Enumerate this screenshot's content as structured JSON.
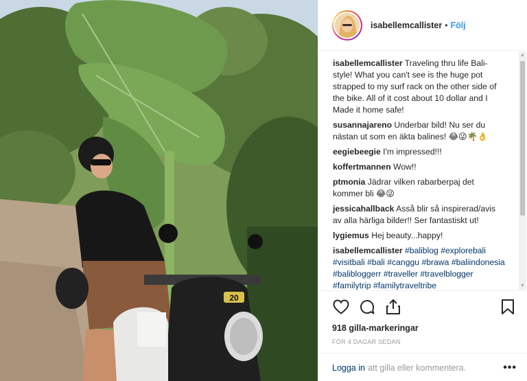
{
  "post": {
    "username": "isabellemcallister",
    "dot": "•",
    "follow_label": "Följ"
  },
  "comments": [
    {
      "user": "isabellemcallister",
      "text": "Traveling thru life Bali-style! What you can't see is the huge pot strapped to my surf rack on the other side of the bike. All of it cost about 10 dollar and I Made it home safe!"
    },
    {
      "user": "susannajareno",
      "text": "Underbar bild! Nu ser du nästan ut som en äkta balines! 😂😜🌴👌"
    },
    {
      "user": "eegiebeegie",
      "text": "I'm impressed!!!"
    },
    {
      "user": "koffertmannen",
      "text": "Wow!!"
    },
    {
      "user": "ptmonia",
      "text": "Jädrar vilken rabarberpaj det kommer bli 😂😜"
    },
    {
      "user": "jessicahallback",
      "text": "Asså blir så inspirerad/avis av alla härliga bilder!! Ser fantastiskt ut!"
    },
    {
      "user": "lygiemus",
      "text": "Hej beauty...happy!"
    }
  ],
  "hashtag_comment": {
    "user": "isabellemcallister",
    "tags": [
      "#baliblog",
      "#explorebali",
      "#visitbali",
      "#bali",
      "#canggu",
      "#brawa",
      "#baliindonesia",
      "#balibloggerr",
      "#traveller",
      "#travelblogger",
      "#familytrip",
      "#familytraveltribe"
    ]
  },
  "likes_text": "918 gilla-markeringar",
  "time_text": "FÖR 4 DAGAR SEDAN",
  "login": {
    "link_label": "Logga in",
    "text": "att gilla eller kommentera.",
    "more_label": "•••"
  },
  "icons": {
    "like": "heart-icon",
    "comment": "speech-bubble-icon",
    "share": "share-icon",
    "save": "bookmark-icon"
  },
  "colors": {
    "link_blue": "#3897f0",
    "hashtag": "#003569",
    "muted": "#999999",
    "text": "#262626"
  },
  "photo": {
    "scooter_number": "20"
  }
}
